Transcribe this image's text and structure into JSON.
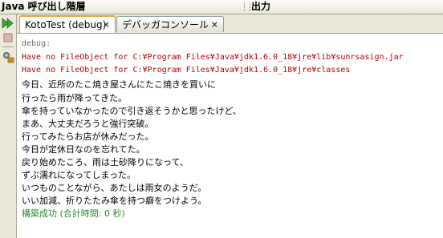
{
  "top": {
    "left_title": "Java 呼び出し階層",
    "right_title": "出力"
  },
  "tabs": [
    {
      "label": "KotoTest (debug)",
      "close": "×"
    },
    {
      "label": "デバッガコンソール",
      "close": "×"
    }
  ],
  "output": {
    "lines": [
      {
        "text": "debug:",
        "kind": "gray"
      },
      {
        "text": "Have no FileObject for C:¥Program Files¥Java¥jdk1.6.0_18¥jre¥lib¥sunrsasign.jar",
        "kind": "red"
      },
      {
        "text": "Have no FileObject for C:¥Program Files¥Java¥jdk1.6.0_18¥jre¥classes",
        "kind": "red"
      },
      {
        "text": "今日、近所のたこ焼き屋さんにたこ焼きを買いに",
        "kind": "black"
      },
      {
        "text": "行ったら雨が降ってきた。",
        "kind": "black"
      },
      {
        "text": "傘を持っていなかったので引き返そうかと思ったけど、",
        "kind": "black"
      },
      {
        "text": "まあ、大丈夫だろうと強行突破。",
        "kind": "black"
      },
      {
        "text": "行ってみたらお店が休みだった。",
        "kind": "black"
      },
      {
        "text": "今日が定休日なのを忘れてた。",
        "kind": "black"
      },
      {
        "text": "戻り始めたころ、雨は土砂降りになって、",
        "kind": "black"
      },
      {
        "text": "ずぶ濡れになってしまった。",
        "kind": "black"
      },
      {
        "text": "いつものことながら、あたしは雨女のようだ。",
        "kind": "black"
      },
      {
        "text": "いい加減、折りたたみ傘を持つ癖をつけよう。",
        "kind": "black"
      },
      {
        "text": "構築成功 (合計時間: 0 秒)",
        "kind": "green"
      }
    ]
  },
  "colors": {
    "error": "#b40000",
    "success": "#2b8a2b",
    "info": "#6d6d6d",
    "active_tab_accent": "#e8a33d"
  },
  "icons": [
    "run-again-icon",
    "stop-icon",
    "debug-settings-icon"
  ]
}
